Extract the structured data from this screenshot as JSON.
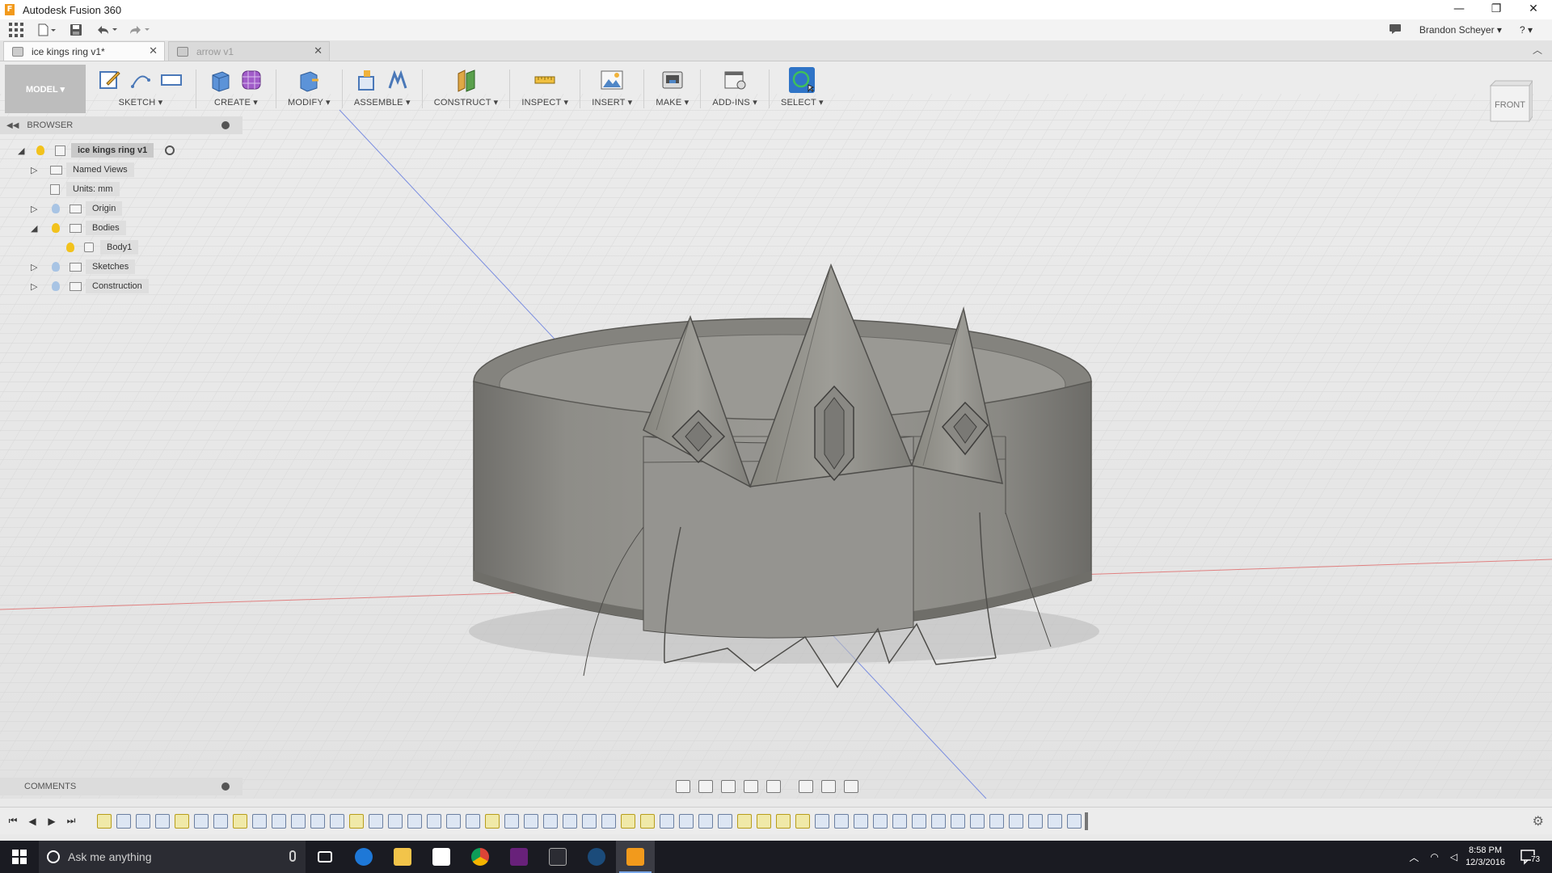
{
  "window": {
    "title": "Autodesk Fusion 360",
    "app_icon_letter": "F",
    "minimize": "—",
    "restore": "❐",
    "close": "✕"
  },
  "qat": {
    "grid_icon": "grid-icon",
    "user_name": "Brandon Scheyer ▾",
    "help_label": "? ▾"
  },
  "tabs": [
    {
      "label": "ice kings ring v1*",
      "active": true
    },
    {
      "label": "arrow v1",
      "active": false
    }
  ],
  "toolbar": {
    "workspace": "MODEL ▾",
    "groups": {
      "sketch": "SKETCH ▾",
      "create": "CREATE ▾",
      "modify": "MODIFY ▾",
      "assemble": "ASSEMBLE ▾",
      "construct": "CONSTRUCT ▾",
      "inspect": "INSPECT ▾",
      "insert": "INSERT ▾",
      "make": "MAKE ▾",
      "addins": "ADD-INS ▾",
      "select": "SELECT ▾"
    }
  },
  "viewcube": {
    "face_label": "FRONT"
  },
  "browser": {
    "title": "BROWSER",
    "items": [
      {
        "label": "ice kings ring v1"
      },
      {
        "label": "Named Views"
      },
      {
        "label": "Units: mm"
      },
      {
        "label": "Origin"
      },
      {
        "label": "Bodies"
      },
      {
        "label": "Body1"
      },
      {
        "label": "Sketches"
      },
      {
        "label": "Construction"
      }
    ]
  },
  "comments": {
    "title": "COMMENTS"
  },
  "timeline": {
    "first": "⏮",
    "prev": "◀",
    "play": "▶",
    "last": "⏭",
    "settings": "⚙"
  },
  "taskbar": {
    "search_placeholder": "Ask me anything",
    "time": "8:58 PM",
    "date": "12/3/2016",
    "notifications": "73"
  },
  "colors": {
    "accent": "#2f74c7",
    "ring_body": "#8c8b86",
    "taskbar": "#1a1b22",
    "fusion_orange": "#f29a1c"
  }
}
